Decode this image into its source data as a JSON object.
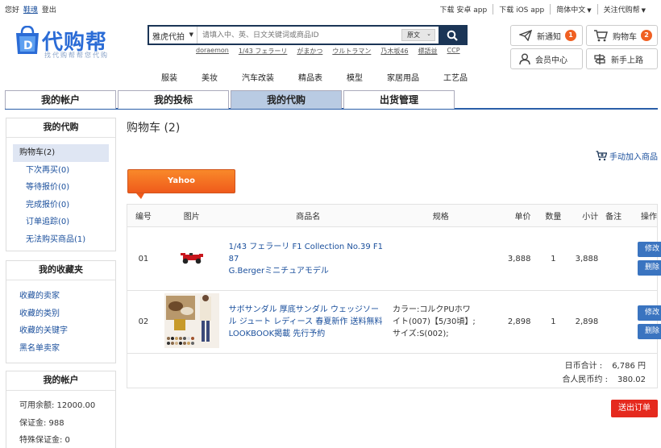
{
  "topbar": {
    "greeting": "您好",
    "username": "鞋魂",
    "logout": "登出",
    "links": [
      {
        "label": "下载 安卓 app",
        "caret": false
      },
      {
        "label": "下载 iOS app",
        "caret": false
      },
      {
        "label": "简体中文",
        "caret": true
      },
      {
        "label": "关注代购帮",
        "caret": true
      }
    ]
  },
  "logo": {
    "name": "代购帮",
    "slogan": "找代购帮帮您代购"
  },
  "search": {
    "category": "雅虎代拍",
    "placeholder": "请填入中、英、日文关键词或商品ID",
    "lang": "原文",
    "hotwords": [
      "doraemon",
      "1/43 フェラーリ",
      "がまかつ",
      "ウルトラマン",
      "乃木坂46",
      "標語益",
      "CCP"
    ]
  },
  "actions": {
    "notice": {
      "label": "新通知",
      "count": "1"
    },
    "cart": {
      "label": "购物车",
      "count": "2"
    },
    "member": {
      "label": "会员中心"
    },
    "newbie": {
      "label": "新手上路"
    }
  },
  "catnav": [
    "服装",
    "美妆",
    "汽车改装",
    "精品表",
    "模型",
    "家居用品",
    "工艺品"
  ],
  "tabs": [
    {
      "label": "我的帐户",
      "active": false
    },
    {
      "label": "我的投标",
      "active": false
    },
    {
      "label": "我的代购",
      "active": true
    },
    {
      "label": "出货管理",
      "active": false
    }
  ],
  "sidebar": {
    "daigou": {
      "title": "我的代购",
      "items": [
        "购物车(2)",
        "下次再买(0)",
        "等待报价(0)",
        "完成报价(0)",
        "订单追踪(0)",
        "无法购买商品(1)"
      ]
    },
    "favorites": {
      "title": "我的收藏夹",
      "items": [
        "收藏的卖家",
        "收藏的类别",
        "收藏的关键字",
        "黑名单卖家"
      ]
    },
    "account": {
      "title": "我的帐户",
      "items": [
        "可用余额: 12000.00",
        "保证金: 988",
        "特殊保证金: 0"
      ]
    }
  },
  "main": {
    "title": "购物车 (2)",
    "manual_add": "手动加入商品",
    "source_tab": "Yahoo",
    "headers": [
      "编号",
      "图片",
      "商品名",
      "规格",
      "单价",
      "数量",
      "小计",
      "备注",
      "操作"
    ],
    "rows": [
      {
        "no": "01",
        "name_l1": "1/43 フェラーリ F1 Collection No.39 F1 87",
        "name_l2": "G.Bergerミニチュアモデル",
        "spec_l1": "",
        "spec_l2": "",
        "spec_l3": "",
        "price": "3,888",
        "qty": "1",
        "subtotal": "3,888",
        "note": ""
      },
      {
        "no": "02",
        "name_l1": "サボサンダル 厚底サンダル ウェッジソー",
        "name_l2": "ル ジュート レディース 春夏新作 送料無料",
        "name_l3": "LOOKBOOK掲載 先行予約",
        "spec_l1": "カラー:コルクPUホワ",
        "spec_l2": "イト(007)【5/30頃】;",
        "spec_l3": "サイズ:S(002);",
        "price": "2,898",
        "qty": "1",
        "subtotal": "2,898",
        "note": ""
      }
    ],
    "ops": {
      "edit": "修改",
      "delete": "删除"
    },
    "totals": {
      "jpy_label": "日币合计 :",
      "jpy_value": "6,786 円",
      "rmb_label": "合人民币约 :",
      "rmb_value": "380.02"
    },
    "submit": "送出订单"
  },
  "colors": {
    "accent": "#2a5ea8",
    "orange": "#ef5a1b",
    "red": "#e52a1e",
    "badge": "#f06022"
  }
}
